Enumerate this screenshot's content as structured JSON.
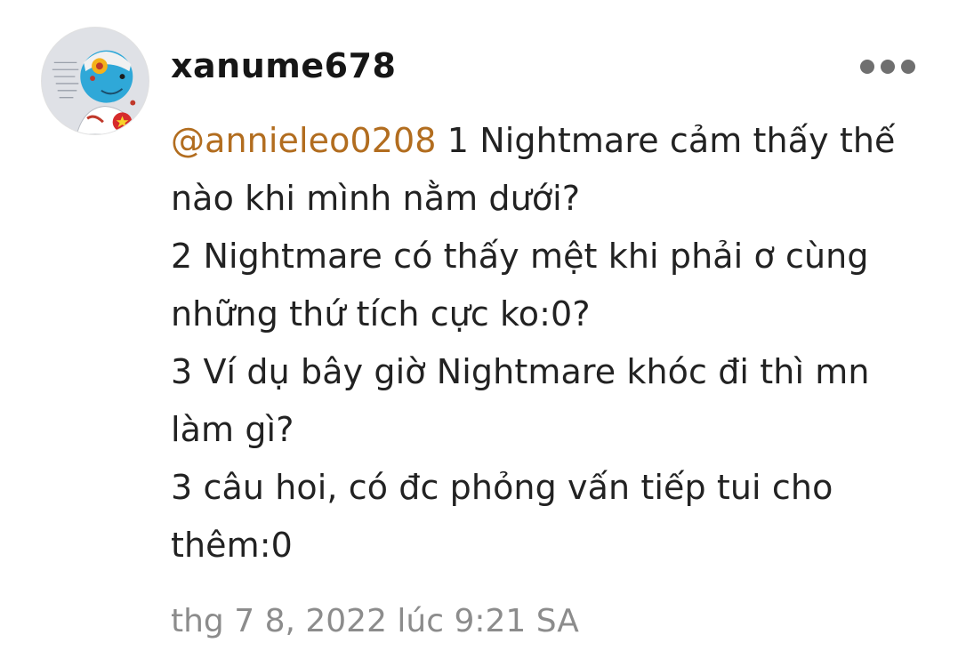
{
  "comment": {
    "username": "xanume678",
    "mention": "@annieleo0208",
    "lines": [
      " 1 Nightmare cảm thấy thế",
      "nào khi mình nằm dưới?",
      "2 Nightmare có thấy mệt khi phải ơ cùng",
      "những thứ tích cực ko:0?",
      "3 Ví dụ bây giờ Nightmare khóc đi thì mn",
      "làm gì?",
      "3 câu hoi, có đc phỏng vấn tiếp tui cho",
      "thêm:0"
    ],
    "timestamp": "thg 7 8, 2022 lúc 9:21 SA",
    "more_icon": "more-horizontal-icon",
    "avatar_description_icon": "user-avatar"
  },
  "colors": {
    "mention": "#b26d1f",
    "timestamp": "#8c8c8c",
    "text": "#222222",
    "more_dots": "#6f6f6f"
  }
}
